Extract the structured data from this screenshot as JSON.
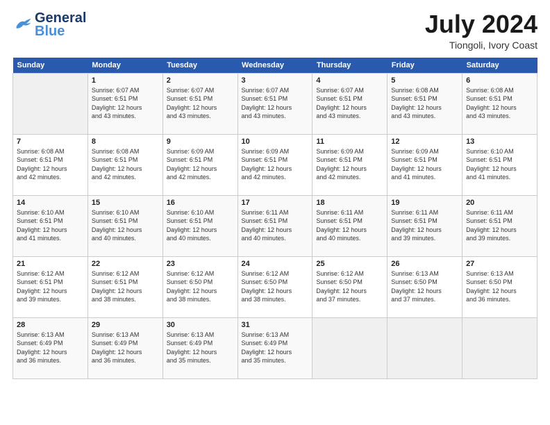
{
  "header": {
    "logo_line1": "General",
    "logo_line2": "Blue",
    "month_title": "July 2024",
    "location": "Tiongoli, Ivory Coast"
  },
  "weekdays": [
    "Sunday",
    "Monday",
    "Tuesday",
    "Wednesday",
    "Thursday",
    "Friday",
    "Saturday"
  ],
  "weeks": [
    [
      {
        "day": "",
        "info": ""
      },
      {
        "day": "1",
        "info": "Sunrise: 6:07 AM\nSunset: 6:51 PM\nDaylight: 12 hours\nand 43 minutes."
      },
      {
        "day": "2",
        "info": "Sunrise: 6:07 AM\nSunset: 6:51 PM\nDaylight: 12 hours\nand 43 minutes."
      },
      {
        "day": "3",
        "info": "Sunrise: 6:07 AM\nSunset: 6:51 PM\nDaylight: 12 hours\nand 43 minutes."
      },
      {
        "day": "4",
        "info": "Sunrise: 6:07 AM\nSunset: 6:51 PM\nDaylight: 12 hours\nand 43 minutes."
      },
      {
        "day": "5",
        "info": "Sunrise: 6:08 AM\nSunset: 6:51 PM\nDaylight: 12 hours\nand 43 minutes."
      },
      {
        "day": "6",
        "info": "Sunrise: 6:08 AM\nSunset: 6:51 PM\nDaylight: 12 hours\nand 43 minutes."
      }
    ],
    [
      {
        "day": "7",
        "info": "Sunrise: 6:08 AM\nSunset: 6:51 PM\nDaylight: 12 hours\nand 42 minutes."
      },
      {
        "day": "8",
        "info": "Sunrise: 6:08 AM\nSunset: 6:51 PM\nDaylight: 12 hours\nand 42 minutes."
      },
      {
        "day": "9",
        "info": "Sunrise: 6:09 AM\nSunset: 6:51 PM\nDaylight: 12 hours\nand 42 minutes."
      },
      {
        "day": "10",
        "info": "Sunrise: 6:09 AM\nSunset: 6:51 PM\nDaylight: 12 hours\nand 42 minutes."
      },
      {
        "day": "11",
        "info": "Sunrise: 6:09 AM\nSunset: 6:51 PM\nDaylight: 12 hours\nand 42 minutes."
      },
      {
        "day": "12",
        "info": "Sunrise: 6:09 AM\nSunset: 6:51 PM\nDaylight: 12 hours\nand 41 minutes."
      },
      {
        "day": "13",
        "info": "Sunrise: 6:10 AM\nSunset: 6:51 PM\nDaylight: 12 hours\nand 41 minutes."
      }
    ],
    [
      {
        "day": "14",
        "info": "Sunrise: 6:10 AM\nSunset: 6:51 PM\nDaylight: 12 hours\nand 41 minutes."
      },
      {
        "day": "15",
        "info": "Sunrise: 6:10 AM\nSunset: 6:51 PM\nDaylight: 12 hours\nand 40 minutes."
      },
      {
        "day": "16",
        "info": "Sunrise: 6:10 AM\nSunset: 6:51 PM\nDaylight: 12 hours\nand 40 minutes."
      },
      {
        "day": "17",
        "info": "Sunrise: 6:11 AM\nSunset: 6:51 PM\nDaylight: 12 hours\nand 40 minutes."
      },
      {
        "day": "18",
        "info": "Sunrise: 6:11 AM\nSunset: 6:51 PM\nDaylight: 12 hours\nand 40 minutes."
      },
      {
        "day": "19",
        "info": "Sunrise: 6:11 AM\nSunset: 6:51 PM\nDaylight: 12 hours\nand 39 minutes."
      },
      {
        "day": "20",
        "info": "Sunrise: 6:11 AM\nSunset: 6:51 PM\nDaylight: 12 hours\nand 39 minutes."
      }
    ],
    [
      {
        "day": "21",
        "info": "Sunrise: 6:12 AM\nSunset: 6:51 PM\nDaylight: 12 hours\nand 39 minutes."
      },
      {
        "day": "22",
        "info": "Sunrise: 6:12 AM\nSunset: 6:51 PM\nDaylight: 12 hours\nand 38 minutes."
      },
      {
        "day": "23",
        "info": "Sunrise: 6:12 AM\nSunset: 6:50 PM\nDaylight: 12 hours\nand 38 minutes."
      },
      {
        "day": "24",
        "info": "Sunrise: 6:12 AM\nSunset: 6:50 PM\nDaylight: 12 hours\nand 38 minutes."
      },
      {
        "day": "25",
        "info": "Sunrise: 6:12 AM\nSunset: 6:50 PM\nDaylight: 12 hours\nand 37 minutes."
      },
      {
        "day": "26",
        "info": "Sunrise: 6:13 AM\nSunset: 6:50 PM\nDaylight: 12 hours\nand 37 minutes."
      },
      {
        "day": "27",
        "info": "Sunrise: 6:13 AM\nSunset: 6:50 PM\nDaylight: 12 hours\nand 36 minutes."
      }
    ],
    [
      {
        "day": "28",
        "info": "Sunrise: 6:13 AM\nSunset: 6:49 PM\nDaylight: 12 hours\nand 36 minutes."
      },
      {
        "day": "29",
        "info": "Sunrise: 6:13 AM\nSunset: 6:49 PM\nDaylight: 12 hours\nand 36 minutes."
      },
      {
        "day": "30",
        "info": "Sunrise: 6:13 AM\nSunset: 6:49 PM\nDaylight: 12 hours\nand 35 minutes."
      },
      {
        "day": "31",
        "info": "Sunrise: 6:13 AM\nSunset: 6:49 PM\nDaylight: 12 hours\nand 35 minutes."
      },
      {
        "day": "",
        "info": ""
      },
      {
        "day": "",
        "info": ""
      },
      {
        "day": "",
        "info": ""
      }
    ]
  ]
}
